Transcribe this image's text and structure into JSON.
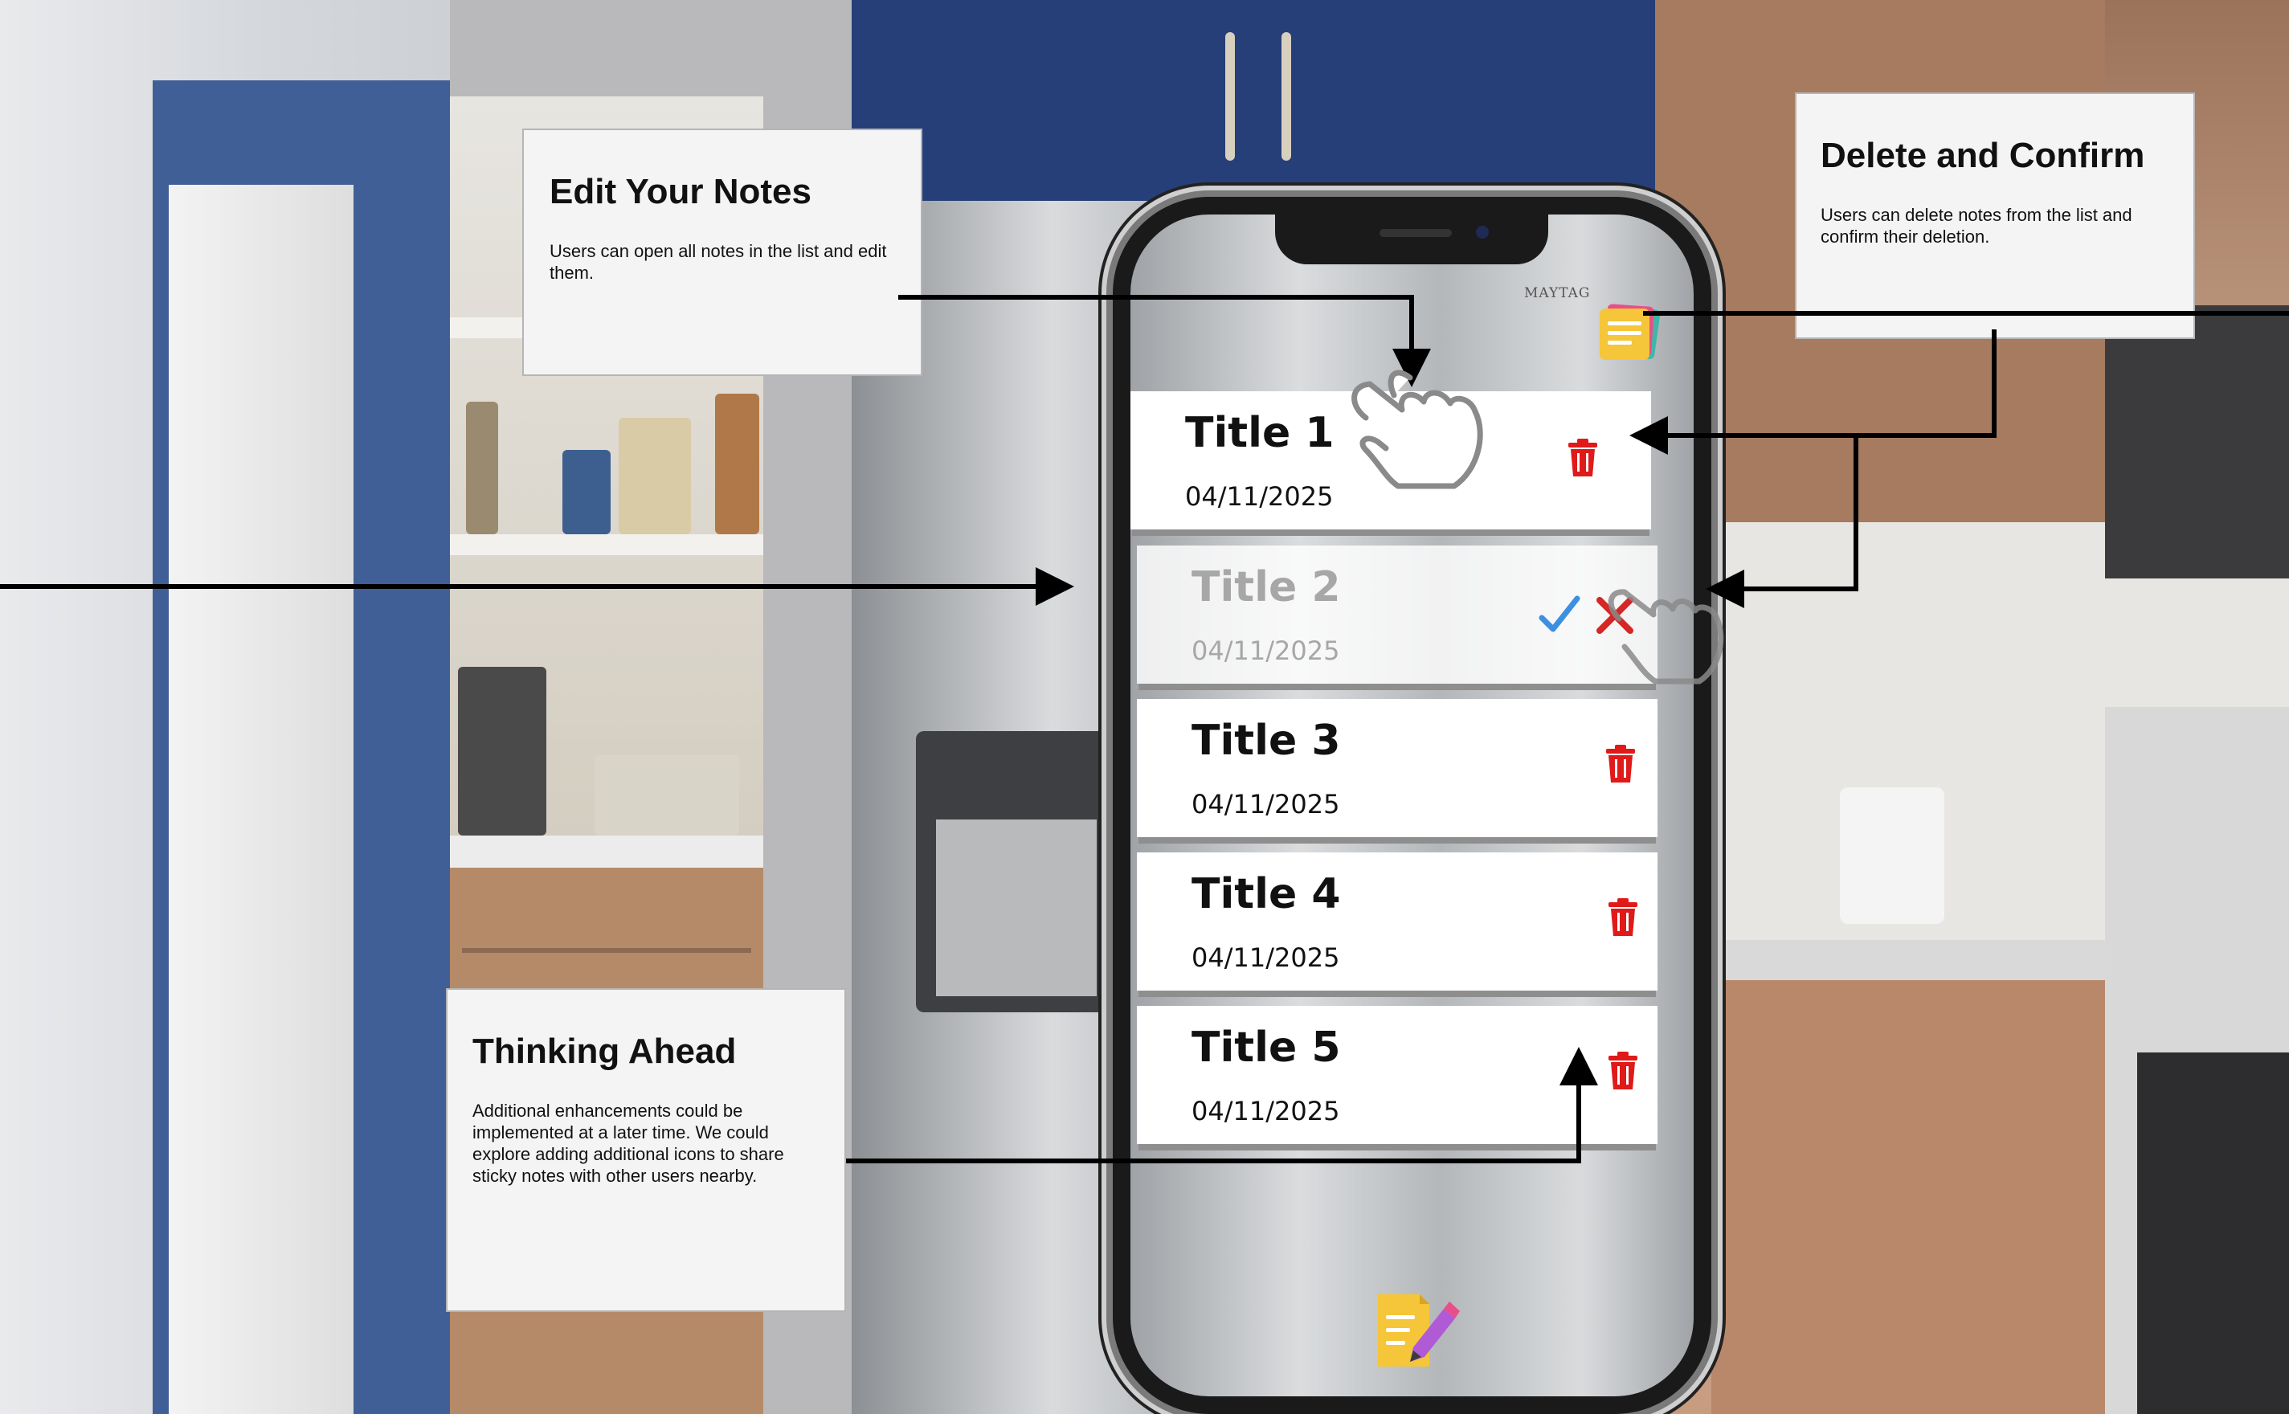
{
  "callouts": {
    "edit": {
      "title": "Edit Your Notes",
      "body": "Users can open all notes in the list and edit them."
    },
    "delete": {
      "title": "Delete and Confirm",
      "body": "Users can delete notes from the list and confirm their deletion."
    },
    "ahead": {
      "title": "Thinking Ahead",
      "body": "Additional enhancements could be implemented at a later time. We could explore adding additional icons to share sticky notes with other users nearby."
    }
  },
  "phone": {
    "background_label": "MAYTAG",
    "notes": [
      {
        "title": "Title 1",
        "date": "04/11/2025",
        "state": "normal"
      },
      {
        "title": "Title 2",
        "date": "04/11/2025",
        "state": "pending-delete"
      },
      {
        "title": "Title 3",
        "date": "04/11/2025",
        "state": "normal"
      },
      {
        "title": "Title 4",
        "date": "04/11/2025",
        "state": "normal"
      },
      {
        "title": "Title 5",
        "date": "04/11/2025",
        "state": "normal"
      }
    ],
    "icons": {
      "top_right": "sticky-notes-stack-icon",
      "bottom": "new-note-pencil-icon",
      "delete": "trash-icon",
      "confirm": "check-icon",
      "cancel": "x-icon",
      "gesture": "tap-hand-icon"
    }
  },
  "colors": {
    "trash": "#e01919",
    "confirm": "#3d8fe0",
    "cancel": "#d62626",
    "callout_bg": "#f4f4f4",
    "sticky_yellow": "#f5c53a",
    "arrow": "#000000"
  }
}
